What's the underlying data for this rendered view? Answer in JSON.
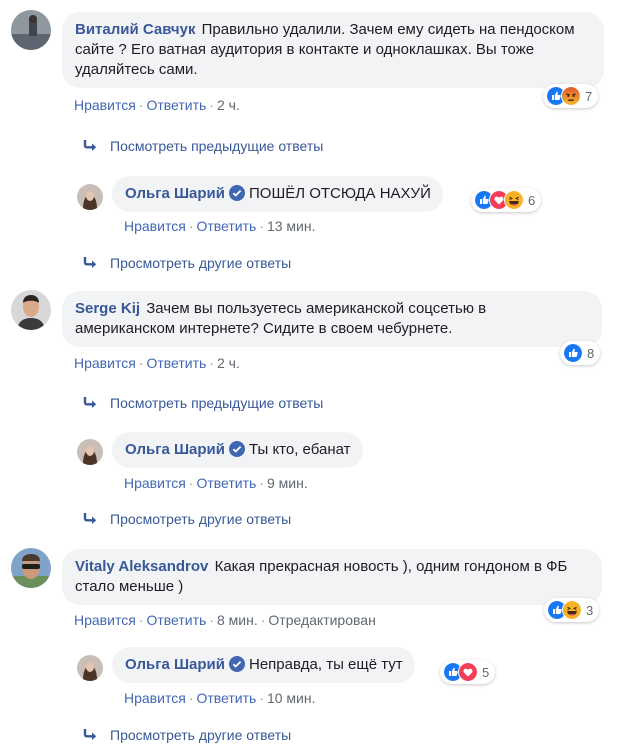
{
  "comments": [
    {
      "author": "Виталий Савчук",
      "text": "Правильно удалили. Зачем ему сидеть на пендоском сайте ? Его ватная аудитория в контакте и одноклашках. Вы тоже удаляйтесь сами.",
      "like_label": "Нравится",
      "reply_label": "Ответить",
      "time": "2 ч.",
      "reactions": {
        "count": "7",
        "icons": [
          "like-reaction",
          "angry-reaction"
        ]
      },
      "previous_replies": "Посмотреть предыдущие ответы",
      "reply": {
        "author": "Ольга Шарий",
        "verified": true,
        "text": "ПОШЁЛ ОТСЮДА НАХУЙ",
        "like_label": "Нравится",
        "reply_label": "Ответить",
        "time": "13 мин.",
        "reactions": {
          "count": "6",
          "icons": [
            "like-reaction",
            "love-reaction",
            "haha-reaction"
          ]
        }
      },
      "more_replies": "Просмотреть другие ответы"
    },
    {
      "author": "Serge Kij",
      "text": "Зачем вы пользуетесь американской соцсетью в американском интернете? Сидите в своем чебурнете.",
      "like_label": "Нравится",
      "reply_label": "Ответить",
      "time": "2 ч.",
      "reactions": {
        "count": "8",
        "icons": [
          "like-reaction"
        ]
      },
      "previous_replies": "Посмотреть предыдущие ответы",
      "reply": {
        "author": "Ольга Шарий",
        "verified": true,
        "text": "Ты кто, ебанат",
        "like_label": "Нравится",
        "reply_label": "Ответить",
        "time": "9 мин."
      },
      "more_replies": "Просмотреть другие ответы"
    },
    {
      "author": "Vitaly Aleksandrov",
      "text": "Какая прекрасная новость ), одним гондоном в ФБ стало меньше )",
      "like_label": "Нравится",
      "reply_label": "Ответить",
      "time": "8 мин.",
      "edited": "Отредактирован",
      "reactions": {
        "count": "3",
        "icons": [
          "like-reaction",
          "haha-reaction"
        ]
      },
      "reply": {
        "author": "Ольга Шарий",
        "verified": true,
        "text": "Неправда, ты ещё тут",
        "like_label": "Нравится",
        "reply_label": "Ответить",
        "time": "10 мин.",
        "reactions": {
          "count": "5",
          "icons": [
            "like-reaction",
            "love-reaction"
          ]
        }
      },
      "more_replies": "Просмотреть другие ответы"
    }
  ],
  "colors": {
    "link": "#385898",
    "action": "#4267b2",
    "bubble": "#f2f3f5",
    "like": "#1877f2",
    "love": "#f33e58",
    "haha": "#f7b125",
    "angry": "#e9710f"
  }
}
